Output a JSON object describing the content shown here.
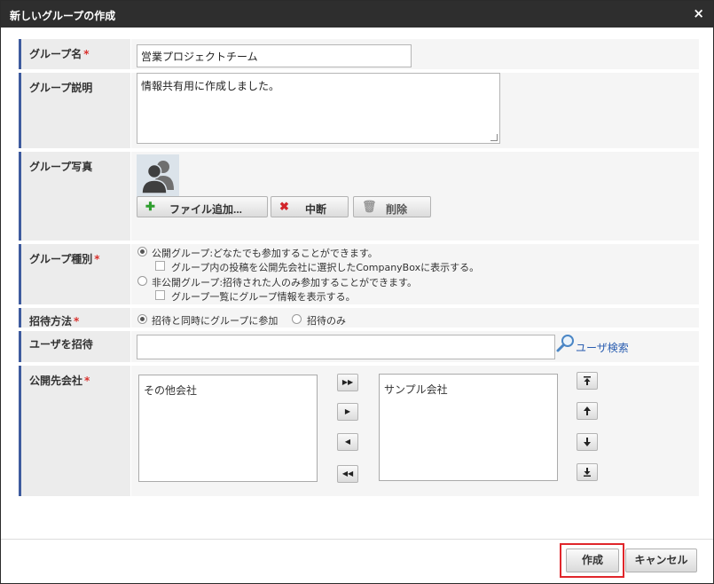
{
  "dialog": {
    "title": "新しいグループの作成",
    "close_glyph": "×"
  },
  "fields": {
    "group_name": {
      "label": "グループ名",
      "required_mark": "*",
      "value": "営業プロジェクトチーム"
    },
    "group_description": {
      "label": "グループ説明",
      "value": "情報共有用に作成しました。"
    },
    "group_photo": {
      "label": "グループ写真",
      "add_file_label": "ファイル追加...",
      "cancel_label": "中断",
      "delete_label": "削除"
    },
    "group_type": {
      "label": "グループ種別",
      "required_mark": "*",
      "options": [
        {
          "label": "公開グループ:どなたでも参加することができます。",
          "checked": true
        },
        {
          "label": "非公開グループ:招待された人のみ参加することができます。",
          "checked": false
        }
      ],
      "public_sub_option": "グループ内の投稿を公開先会社に選択したCompanyBoxに表示する。",
      "private_sub_option": "グループ一覧にグループ情報を表示する。"
    },
    "invite_method": {
      "label": "招待方法",
      "required_mark": "*",
      "options": [
        {
          "label": "招待と同時にグループに参加",
          "checked": true
        },
        {
          "label": "招待のみ",
          "checked": false
        }
      ]
    },
    "invite_user": {
      "label": "ユーザを招待",
      "value": "",
      "search_link": "ユーザ検索"
    },
    "public_company": {
      "label": "公開先会社",
      "required_mark": "*",
      "available": [
        "その他会社"
      ],
      "selected": [
        "サンプル会社"
      ],
      "move_buttons": [
        "▶▶",
        "▶",
        "◀",
        "◀◀"
      ],
      "order_buttons": [
        "top",
        "up",
        "down",
        "bottom"
      ]
    }
  },
  "footer": {
    "create_label": "作成",
    "cancel_label": "キャンセル"
  },
  "colors": {
    "titlebar": "#2e2e2e",
    "label_accent": "#3e5b9e",
    "required": "#d9322e",
    "highlight": "#e0262b",
    "link": "#2a5db0"
  }
}
